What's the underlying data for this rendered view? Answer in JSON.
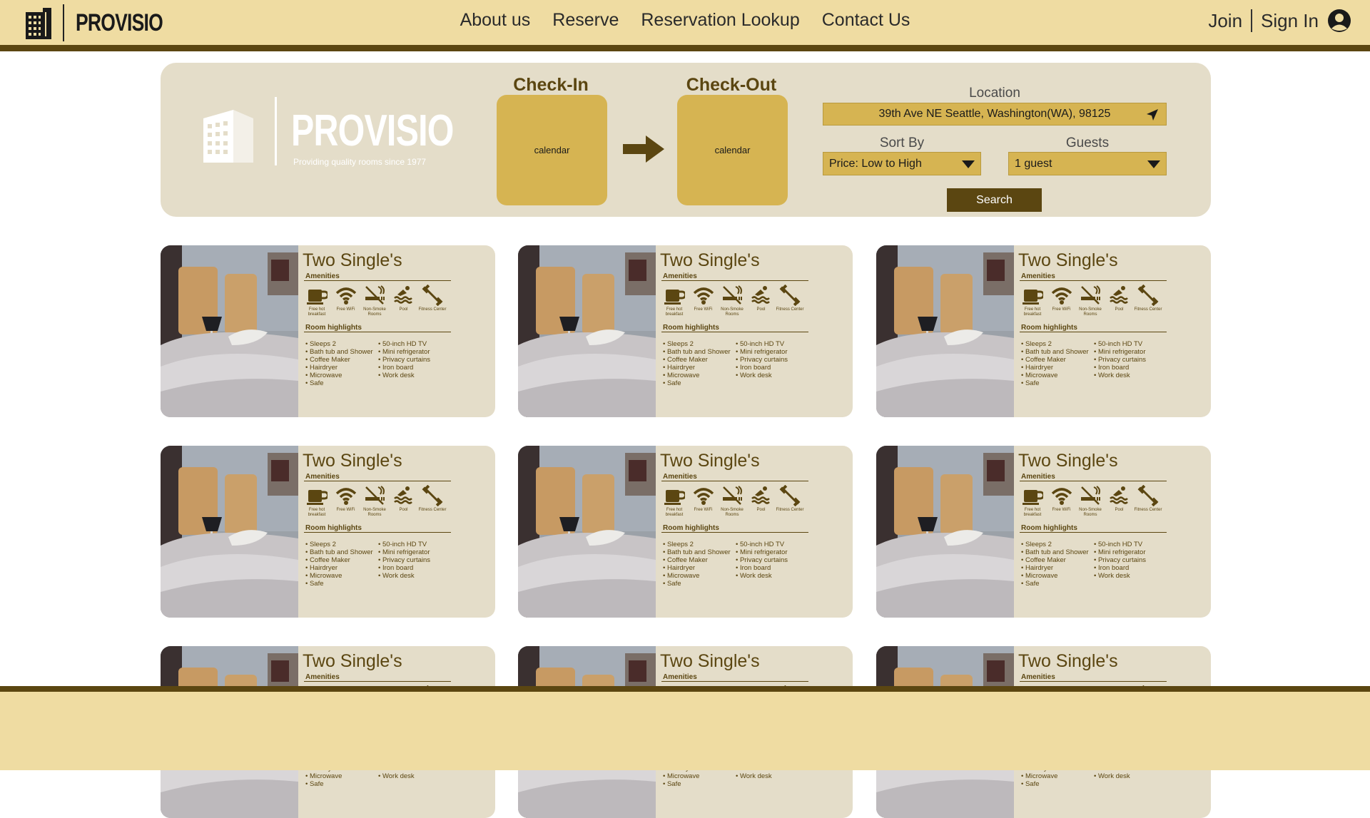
{
  "brand": {
    "name": "PROVISIO",
    "tagline": "Providing quality rooms since 1977"
  },
  "nav": {
    "items": [
      "About us",
      "Reserve",
      "Reservation Lookup",
      "Contact Us"
    ]
  },
  "account": {
    "join": "Join",
    "sign_in": "Sign In"
  },
  "search": {
    "check_in_label": "Check-In",
    "check_out_label": "Check-Out",
    "check_in_calendar": "calendar",
    "check_out_calendar": "calendar",
    "location_label": "Location",
    "location_value": "39th Ave NE Seattle, Washington(WA), 98125",
    "sort_label": "Sort By",
    "sort_value": "Price: Low to High",
    "guests_label": "Guests",
    "guests_value": "1 guest",
    "button": "Search"
  },
  "card_template": {
    "title": "Two Single's",
    "amenities_title": "Amenities",
    "amenities": [
      {
        "icon": "coffee-cup-icon",
        "label": "Free hot breakfast"
      },
      {
        "icon": "wifi-icon",
        "label": "Free WiFi"
      },
      {
        "icon": "no-smoking-icon",
        "label": "Non-Smoke Rooms"
      },
      {
        "icon": "pool-icon",
        "label": "Pool"
      },
      {
        "icon": "dumbbell-icon",
        "label": "Fitness Center"
      }
    ],
    "highlights_title": "Room highlights",
    "highlights_left": [
      "Sleeps 2",
      "Bath tub and Shower",
      "Coffee Maker",
      "Hairdryer",
      "Microwave",
      "Safe"
    ],
    "highlights_right": [
      "50-inch HD TV",
      "Mini refrigerator",
      "Privacy curtains",
      "Iron board",
      "Work desk"
    ]
  },
  "rooms": [
    {
      "title": "Two Single's"
    },
    {
      "title": "Two Single's"
    },
    {
      "title": "Two Single's"
    },
    {
      "title": "Two Single's"
    },
    {
      "title": "Two Single's"
    },
    {
      "title": "Two Single's"
    },
    {
      "title": "Two Single's"
    },
    {
      "title": "Two Single's"
    },
    {
      "title": "Two Single's"
    }
  ],
  "colors": {
    "header_bg": "#efdca2",
    "accent_dark": "#5b4611",
    "gold": "#d6b452",
    "panel_bg": "#e4ddc9"
  }
}
